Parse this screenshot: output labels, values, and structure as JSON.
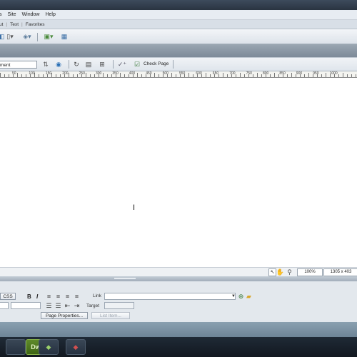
{
  "menu": [
    "s",
    "Site",
    "Window",
    "Help"
  ],
  "insert_tabs": [
    "ut",
    "Text",
    "Favorites"
  ],
  "doc_toolbar": {
    "title_value": "ment",
    "check_page_label": "Check Page"
  },
  "ruler_labels": [
    "50",
    "100",
    "150",
    "200",
    "250",
    "300",
    "350",
    "400",
    "450",
    "500",
    "550",
    "600",
    "650",
    "700",
    "750",
    "800",
    "850",
    "900",
    "950",
    "1000"
  ],
  "status": {
    "zoom": "100%",
    "window_size": "1305 x 403"
  },
  "properties": {
    "css_button": "CSS",
    "bold": "B",
    "italic": "I",
    "link_label": "Link",
    "target_label": "Target",
    "page_properties": "Page Properties...",
    "list_item": "List Item..."
  },
  "taskbar": {
    "dw_label": "Dw"
  }
}
